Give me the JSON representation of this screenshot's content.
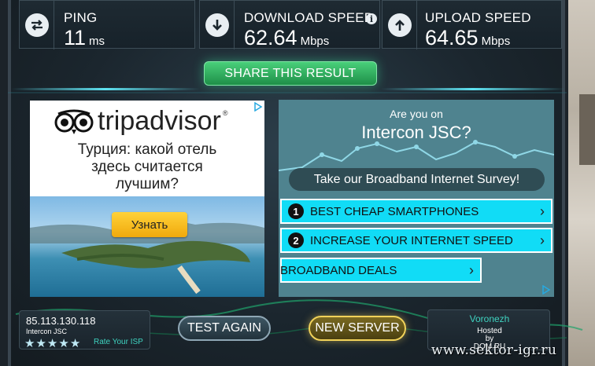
{
  "stats": {
    "ping": {
      "label": "PING",
      "value": "11",
      "unit": "ms"
    },
    "download": {
      "label": "DOWNLOAD SPEED",
      "value": "62.64",
      "unit": "Mbps"
    },
    "upload": {
      "label": "UPLOAD SPEED",
      "value": "64.65",
      "unit": "Mbps"
    }
  },
  "share_label": "SHARE THIS RESULT",
  "ad_left": {
    "brand": "tripadvisor",
    "text_line1": "Турция: какой отель",
    "text_line2": "здесь считается",
    "text_line3": "лучшим?",
    "button": "Узнать"
  },
  "ad_right": {
    "question1": "Are you on",
    "question2": "Intercon JSC?",
    "survey": "Take our Broadband Internet Survey!",
    "items": [
      {
        "num": "1",
        "label": "BEST CHEAP SMARTPHONES"
      },
      {
        "num": "2",
        "label": "INCREASE YOUR INTERNET SPEED"
      },
      {
        "num": "",
        "label": "BROADBAND DEALS"
      }
    ]
  },
  "client": {
    "ip": "85.113.130.118",
    "isp": "Intercon JSC",
    "rating_stars": 5,
    "rate_label": "Rate Your ISP"
  },
  "buttons": {
    "test_again": "TEST AGAIN",
    "new_server": "NEW SERVER"
  },
  "server": {
    "city": "Voronezh",
    "hosted_line1": "Hosted",
    "hosted_line2": "by",
    "host": "DOM.RU"
  },
  "watermark": "www.sektor-igr.ru",
  "colors": {
    "accent_green": "#2fbf67",
    "accent_cyan": "#11dcf6",
    "accent_gold": "#f1d25a",
    "rate_teal": "#3fd3c0"
  }
}
